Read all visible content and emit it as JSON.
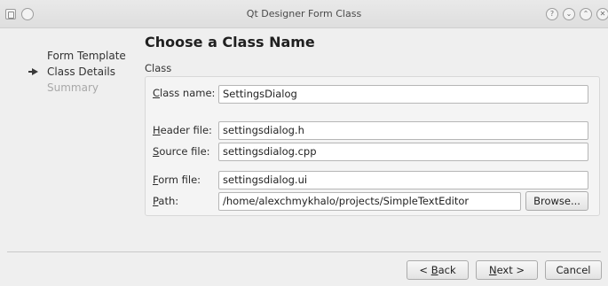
{
  "window": {
    "title": "Qt Designer Form Class",
    "buttons": {
      "help": "?",
      "minimize": "⌄",
      "maximize": "⌃",
      "close": "✕"
    }
  },
  "steps": [
    {
      "label": "Form Template",
      "state": "done"
    },
    {
      "label": "Class Details",
      "state": "current"
    },
    {
      "label": "Summary",
      "state": "pending"
    }
  ],
  "page": {
    "title": "Choose a Class Name",
    "section": "Class"
  },
  "fields": {
    "class_name": {
      "mnemonic": "C",
      "rest": "lass name:",
      "value": "SettingsDialog"
    },
    "header_file": {
      "mnemonic": "H",
      "rest": "eader file:",
      "value": "settingsdialog.h"
    },
    "source_file": {
      "mnemonic": "S",
      "rest": "ource file:",
      "value": "settingsdialog.cpp"
    },
    "form_file": {
      "mnemonic": "F",
      "rest": "orm file:",
      "value": "settingsdialog.ui"
    },
    "path": {
      "mnemonic": "P",
      "rest": "ath:",
      "value": "/home/alexchmykhalo/projects/SimpleTextEditor"
    }
  },
  "actions": {
    "browse": "Browse...",
    "back": {
      "pre": "< ",
      "mnemonic": "B",
      "post": "ack"
    },
    "next": {
      "mnemonic": "N",
      "post": "ext >"
    },
    "cancel": "Cancel"
  }
}
